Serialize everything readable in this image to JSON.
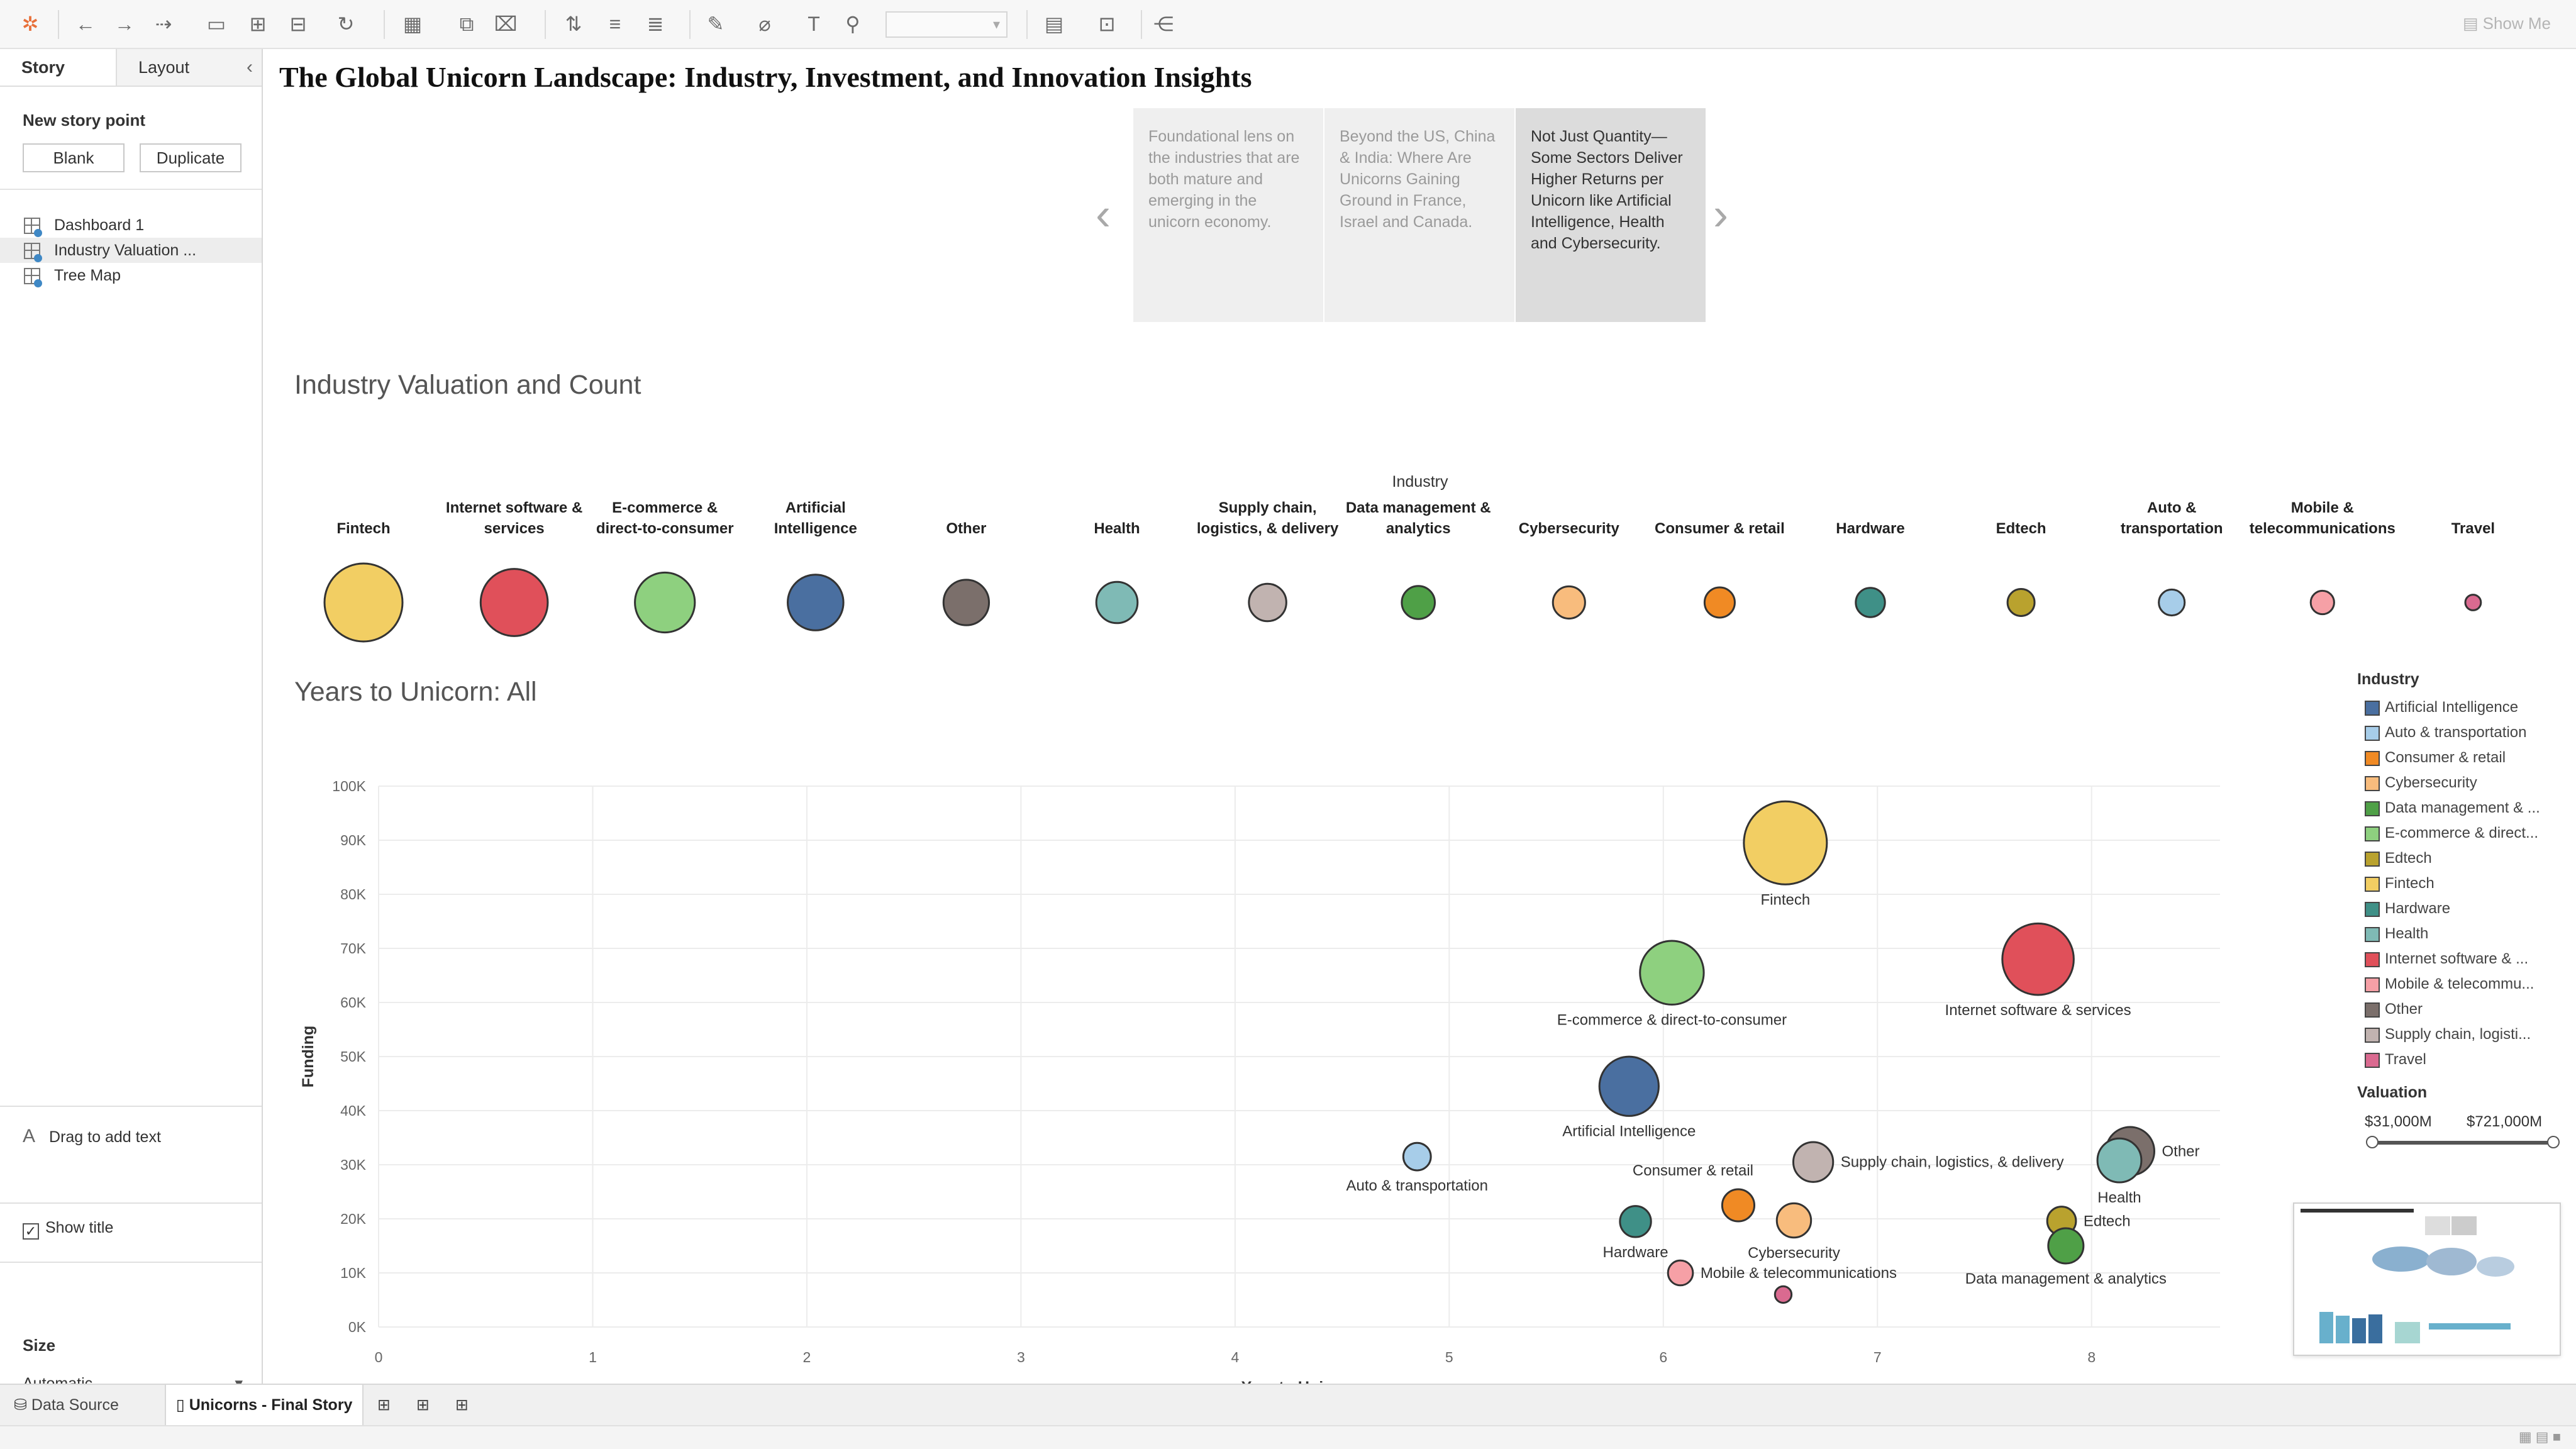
{
  "app": {
    "show_me": "Show Me"
  },
  "left_panel": {
    "tabs": [
      "Story",
      "Layout"
    ],
    "new_story_point": "New story point",
    "blank_button": "Blank",
    "duplicate_button": "Duplicate",
    "story_points": [
      "Dashboard 1",
      "Industry Valuation ...",
      "Tree Map"
    ],
    "drag_to_add_text": "Drag to add text",
    "show_title": "Show title",
    "size_label": "Size",
    "size_value": "Automatic"
  },
  "story": {
    "title": "The Global Unicorn Landscape: Industry, Investment, and Innovation Insights",
    "points": [
      "Foundational lens on the industries that are both mature and emerging in the unicorn economy.",
      "Beyond the US, China & India: Where Are Unicorns Gaining Ground in France, Israel and Canada.",
      "Not Just Quantity—Some Sectors Deliver Higher Returns per Unicorn like Artificial Intelligence, Health and Cybersecurity."
    ],
    "active_point": 2
  },
  "valuation_chart": {
    "title": "Industry Valuation and Count",
    "header": "Industry"
  },
  "scatter_chart": {
    "title": "Years to Unicorn: All"
  },
  "legend": {
    "title": "Industry",
    "items": [
      {
        "label": "Artificial Intelligence",
        "color": "#4a6fa0"
      },
      {
        "label": "Auto & transportation",
        "color": "#a7cde9"
      },
      {
        "label": "Consumer & retail",
        "color": "#f08a24"
      },
      {
        "label": "Cybersecurity",
        "color": "#f8bc7d"
      },
      {
        "label": "Data management & ...",
        "color": "#4fa047"
      },
      {
        "label": "E-commerce & direct...",
        "color": "#8ed07f"
      },
      {
        "label": "Edtech",
        "color": "#b9a22e"
      },
      {
        "label": "Fintech",
        "color": "#f2ce63"
      },
      {
        "label": "Hardware",
        "color": "#3f9087"
      },
      {
        "label": "Health",
        "color": "#7fbab5"
      },
      {
        "label": "Internet software & ...",
        "color": "#e0505a"
      },
      {
        "label": "Mobile & telecommu...",
        "color": "#f6a0a6"
      },
      {
        "label": "Other",
        "color": "#7b6f6b"
      },
      {
        "label": "Supply chain, logisti...",
        "color": "#c1b3b0"
      },
      {
        "label": "Travel",
        "color": "#da6a90"
      }
    ],
    "valuation_title": "Valuation",
    "valuation_min": "$31,000M",
    "valuation_max": "$721,000M",
    "valuation_range": [
      0,
      1
    ]
  },
  "bottom_tabs": {
    "data_source": "Data Source",
    "sheet": "Unicorns - Final Story"
  },
  "chart_data": [
    {
      "type": "scatter",
      "title": "Industry Valuation and Count",
      "header": "Industry",
      "categories": [
        "Fintech",
        "Internet software & services",
        "E-commerce & direct-to-consumer",
        "Artificial Intelligence",
        "Other",
        "Health",
        "Supply chain, logistics, & delivery",
        "Data management & analytics",
        "Cybersecurity",
        "Consumer & retail",
        "Hardware",
        "Edtech",
        "Auto & transportation",
        "Mobile & telecommunications",
        "Travel"
      ],
      "label_lines": [
        [
          "Fintech"
        ],
        [
          "Internet software &",
          "services"
        ],
        [
          "E-commerce &",
          "direct-to-consumer"
        ],
        [
          "Artificial",
          "Intelligence"
        ],
        [
          "Other"
        ],
        [
          "Health"
        ],
        [
          "Supply chain,",
          "logistics, & delivery"
        ],
        [
          "Data management &",
          "analytics"
        ],
        [
          "Cybersecurity"
        ],
        [
          "Consumer & retail"
        ],
        [
          "Hardware"
        ],
        [
          "Edtech"
        ],
        [
          "Auto &",
          "transportation"
        ],
        [
          "Mobile &",
          "telecommunications"
        ],
        [
          "Travel"
        ]
      ],
      "size_value": [
        100,
        74,
        59,
        51,
        34,
        28,
        23,
        18,
        17,
        15,
        14,
        12,
        11,
        9,
        4
      ],
      "colors": [
        "#f2ce63",
        "#e0505a",
        "#8ed07f",
        "#4a6fa0",
        "#7b6f6b",
        "#7fbab5",
        "#c1b3b0",
        "#4fa047",
        "#f8bc7d",
        "#f08a24",
        "#3f9087",
        "#b9a22e",
        "#a7cde9",
        "#f6a0a6",
        "#da6a90"
      ]
    },
    {
      "type": "scatter",
      "title": "Years to Unicorn: All",
      "xlabel": "Year to Unicorn",
      "ylabel": "Funding",
      "xlim": [
        0,
        8.6
      ],
      "ylim": [
        0,
        100000
      ],
      "x_ticks": [
        "0",
        "1",
        "2",
        "3",
        "4",
        "5",
        "6",
        "7",
        "8"
      ],
      "y_ticks": [
        "0K",
        "10K",
        "20K",
        "30K",
        "40K",
        "50K",
        "60K",
        "70K",
        "80K",
        "90K",
        "100K"
      ],
      "grid": true,
      "points": [
        {
          "label": "Fintech",
          "x": 6.57,
          "y": 89500,
          "size": 100,
          "color": "#f2ce63",
          "label_pos": "below"
        },
        {
          "label": "Internet software & services",
          "x": 7.75,
          "y": 68000,
          "size": 74,
          "color": "#e0505a",
          "label_pos": "below"
        },
        {
          "label": "E-commerce & direct-to-consumer",
          "x": 6.04,
          "y": 65500,
          "size": 59,
          "color": "#8ed07f",
          "label_pos": "below"
        },
        {
          "label": "Artificial Intelligence",
          "x": 5.84,
          "y": 44500,
          "size": 51,
          "color": "#4a6fa0",
          "label_pos": "below"
        },
        {
          "label": "Other",
          "x": 8.18,
          "y": 32500,
          "size": 34,
          "color": "#7b6f6b",
          "label_pos": "right"
        },
        {
          "label": "Health",
          "x": 8.13,
          "y": 30800,
          "size": 28,
          "color": "#7fbab5",
          "label_pos": "below"
        },
        {
          "label": "Supply chain, logistics, & delivery",
          "x": 6.7,
          "y": 30500,
          "size": 23,
          "color": "#c1b3b0",
          "label_pos": "right"
        },
        {
          "label": "Auto & transportation",
          "x": 4.85,
          "y": 31500,
          "size": 11,
          "color": "#a7cde9",
          "label_pos": "below"
        },
        {
          "label": "Consumer & retail",
          "x": 6.35,
          "y": 22500,
          "size": 15,
          "color": "#f08a24",
          "label_pos": "above-left"
        },
        {
          "label": "Cybersecurity",
          "x": 6.61,
          "y": 19700,
          "size": 17,
          "color": "#f8bc7d",
          "label_pos": "below"
        },
        {
          "label": "Hardware",
          "x": 5.87,
          "y": 19500,
          "size": 14,
          "color": "#3f9087",
          "label_pos": "below"
        },
        {
          "label": "Edtech",
          "x": 7.86,
          "y": 19600,
          "size": 12,
          "color": "#b9a22e",
          "label_pos": "right"
        },
        {
          "label": "Data management & analytics",
          "x": 7.88,
          "y": 15000,
          "size": 18,
          "color": "#4fa047",
          "label_pos": "below"
        },
        {
          "label": "Mobile & telecommunications",
          "x": 6.08,
          "y": 10000,
          "size": 9,
          "color": "#f6a0a6",
          "label_pos": "right"
        },
        {
          "label": "Travel",
          "x": 6.56,
          "y": 6000,
          "size": 4,
          "color": "#da6a90",
          "label_pos": "none"
        }
      ]
    }
  ]
}
